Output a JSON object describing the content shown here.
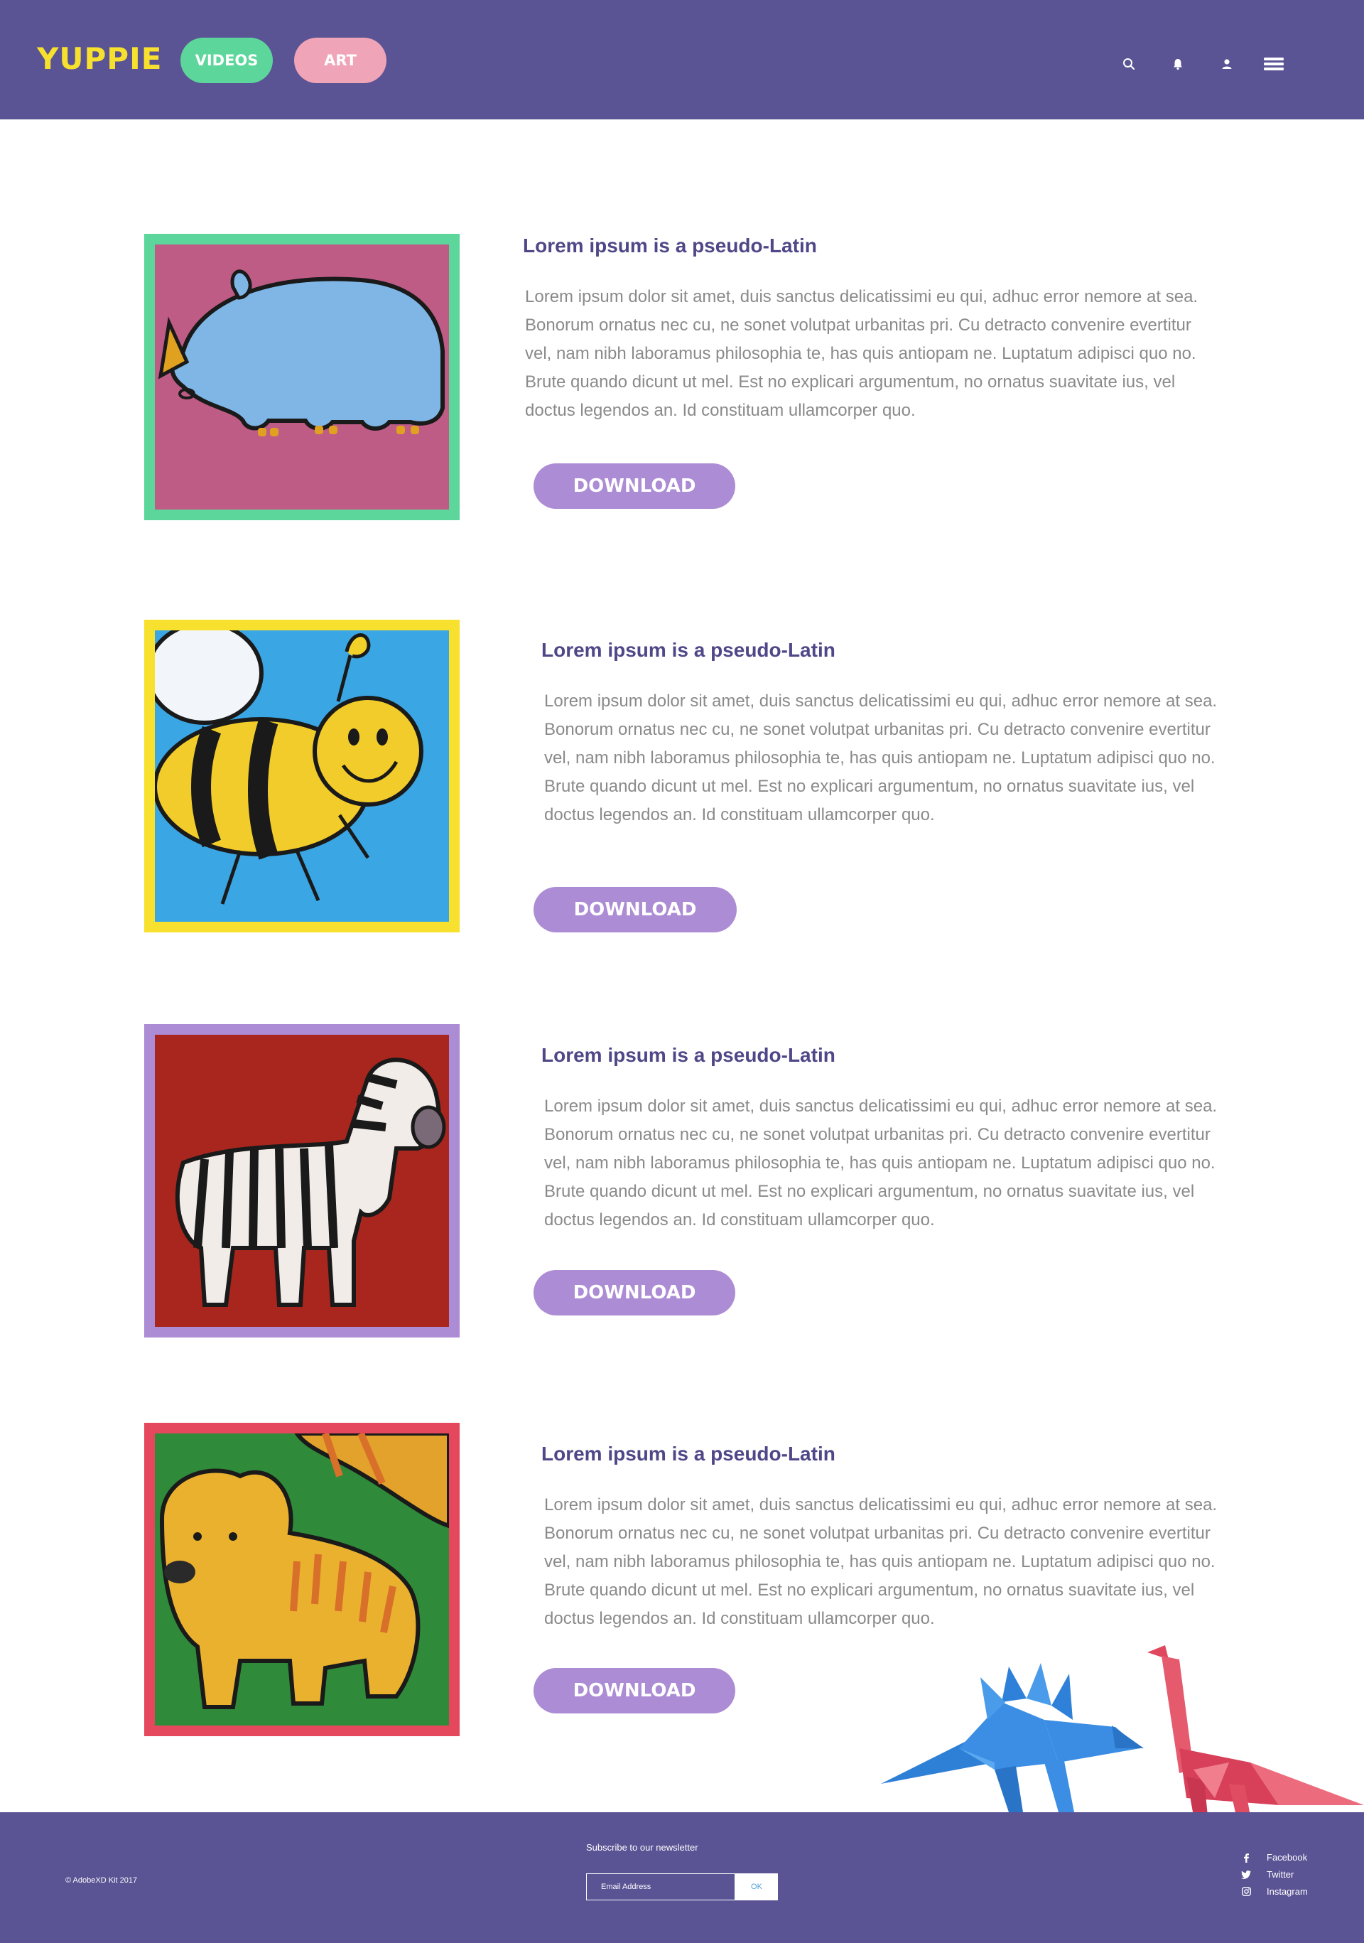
{
  "header": {
    "logo": "YUPPIE",
    "nav": {
      "videos": "VIDEOS",
      "art": "ART"
    },
    "icons": [
      "search-icon",
      "bell-icon",
      "user-icon",
      "menu-icon"
    ]
  },
  "colors": {
    "header_bg": "#5a5394",
    "logo": "#f7e12e",
    "videos_pill": "#5cd69a",
    "art_pill": "#f0a4b8",
    "title": "#4f4787",
    "body_text": "#8a8a8a",
    "download_button": "#ac8cd4",
    "frames": [
      "#5cd69a",
      "#f7e12e",
      "#ac8cd4",
      "#e5485d"
    ]
  },
  "cards": [
    {
      "image": "rhino painting",
      "title": "Lorem ipsum is a pseudo-Latin",
      "body": "Lorem ipsum dolor sit amet, duis sanctus delicatissimi eu qui, adhuc error nemore at sea. Bonorum ornatus nec cu, ne sonet volutpat urbanitas pri. Cu detracto convenire evertitur vel, nam nibh laboramus philosophia te, has quis antiopam ne. Luptatum adipisci quo no. Brute quando dicunt ut mel. Est no explicari argumentum, no ornatus suavitate ius, vel doctus legendos an. Id constituam ullamcorper quo.",
      "button": "DOWNLOAD"
    },
    {
      "image": "bee painting",
      "title": "Lorem ipsum is a pseudo-Latin",
      "body": "Lorem ipsum dolor sit amet, duis sanctus delicatissimi eu qui, adhuc error nemore at sea. Bonorum ornatus nec cu, ne sonet volutpat urbanitas pri. Cu detracto convenire evertitur vel, nam nibh laboramus philosophia te, has quis antiopam ne. Luptatum adipisci quo no. Brute quando dicunt ut mel. Est no explicari argumentum, no ornatus suavitate ius, vel doctus legendos an. Id constituam ullamcorper quo.",
      "button": "DOWNLOAD"
    },
    {
      "image": "zebra painting",
      "title": "Lorem ipsum is a pseudo-Latin",
      "body": "Lorem ipsum dolor sit amet, duis sanctus delicatissimi eu qui, adhuc error nemore at sea. Bonorum ornatus nec cu, ne sonet volutpat urbanitas pri. Cu detracto convenire evertitur vel, nam nibh laboramus philosophia te, has quis antiopam ne. Luptatum adipisci quo no. Brute quando dicunt ut mel. Est no explicari argumentum, no ornatus suavitate ius, vel doctus legendos an. Id constituam ullamcorper quo.",
      "button": "DOWNLOAD"
    },
    {
      "image": "tiger painting",
      "title": "Lorem ipsum is a pseudo-Latin",
      "body": "Lorem ipsum dolor sit amet, duis sanctus delicatissimi eu qui, adhuc error nemore at sea. Bonorum ornatus nec cu, ne sonet volutpat urbanitas pri. Cu detracto convenire evertitur vel, nam nibh laboramus philosophia te, has quis antiopam ne. Luptatum adipisci quo no. Brute quando dicunt ut mel. Est no explicari argumentum, no ornatus suavitate ius, vel doctus legendos an. Id constituam ullamcorper quo.",
      "button": "DOWNLOAD"
    }
  ],
  "decoration": [
    "origami-stegosaurus",
    "origami-brachiosaurus"
  ],
  "footer": {
    "copyright": "© AdobeXD Kit 2017",
    "newsletter_label": "Subscribe to our newsletter",
    "email_placeholder": "Email Address",
    "ok_label": "OK",
    "social": [
      {
        "label": "Facebook",
        "icon": "facebook-icon"
      },
      {
        "label": "Twitter",
        "icon": "twitter-icon"
      },
      {
        "label": "Instagram",
        "icon": "instagram-icon"
      }
    ]
  }
}
